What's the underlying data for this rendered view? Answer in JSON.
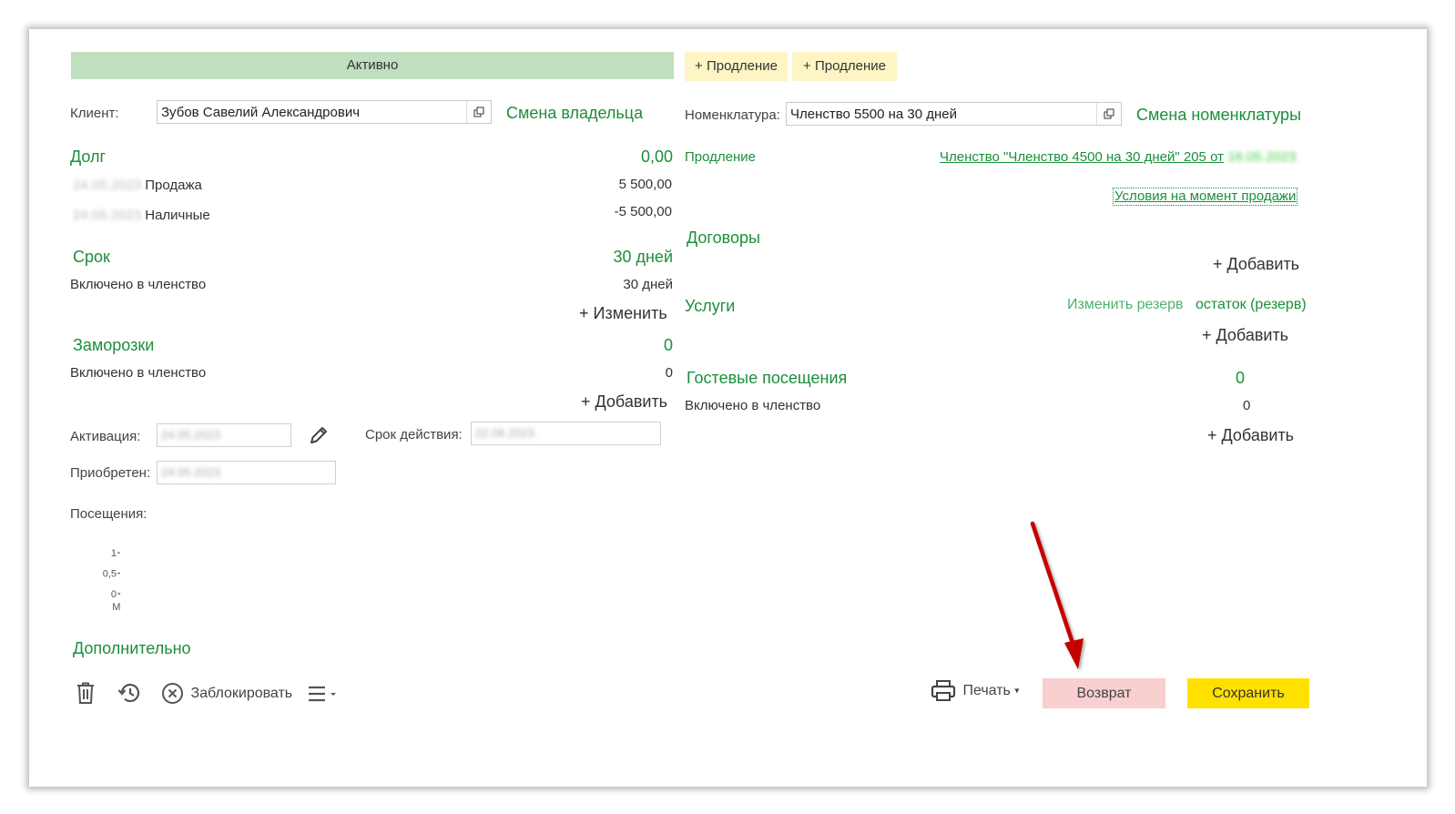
{
  "status": {
    "label": "Активно"
  },
  "extensions": [
    "+ Продление",
    "+ Продление"
  ],
  "client": {
    "label": "Клиент:",
    "value": "Зубов Савелий Александрович",
    "action": "Смена владельца"
  },
  "nomenclature": {
    "label": "Номенклатура:",
    "value": "Членство 5500 на 30 дней",
    "action": "Смена номенклатуры"
  },
  "renewal": {
    "label": "Продление",
    "link": "Членство \"Членство 4500 на 30 дней\" 205 от",
    "link_date": "16.05.2023",
    "conditions_link": "Условия на момент продажи"
  },
  "debt": {
    "title": "Долг",
    "total": "0,00",
    "rows": [
      {
        "date": "24.05.2023",
        "label": "Продажа",
        "amount": "5 500,00"
      },
      {
        "date": "24.05.2023",
        "label": "Наличные",
        "amount": "-5 500,00"
      }
    ]
  },
  "term": {
    "title": "Срок",
    "total": "30 дней",
    "row_label": "Включено в членство",
    "row_value": "30 дней",
    "action": "+ Изменить"
  },
  "freezes": {
    "title": "Заморозки",
    "total": "0",
    "row_label": "Включено в членство",
    "row_value": "0",
    "action": "+ Добавить"
  },
  "contracts": {
    "title": "Договоры",
    "action": "+ Добавить"
  },
  "services": {
    "title": "Услуги",
    "change_reserve": "Изменить резерв",
    "balance": "остаток (резерв)",
    "action": "+ Добавить"
  },
  "guest_visits": {
    "title": "Гостевые посещения",
    "total": "0",
    "row_label": "Включено в членство",
    "row_value": "0",
    "action": "+ Добавить"
  },
  "activation": {
    "label": "Активация:",
    "value": "24.05.2023"
  },
  "validity": {
    "label": "Срок действия:",
    "value": "22.06.2023"
  },
  "acquired": {
    "label": "Приобретен:",
    "value": "24.05.2023"
  },
  "visits": {
    "label": "Посещения:"
  },
  "chart_data": {
    "type": "line",
    "categories": [
      "Май"
    ],
    "series": [
      {
        "values": [
          0
        ]
      }
    ],
    "ylim": [
      0,
      1
    ],
    "yticks": [
      "1",
      "0,5",
      "0"
    ]
  },
  "additional": {
    "title": "Дополнительно"
  },
  "toolbar": {
    "block_label": "Заблокировать",
    "print_label": "Печать",
    "return_label": "Возврат",
    "save_label": "Сохранить"
  },
  "colors": {
    "accent_green": "#1b8f3a",
    "status_bg": "#bfdfbf",
    "save_bg": "#ffe000",
    "return_bg": "#f9cfd0",
    "arrow": "#cc0000"
  }
}
